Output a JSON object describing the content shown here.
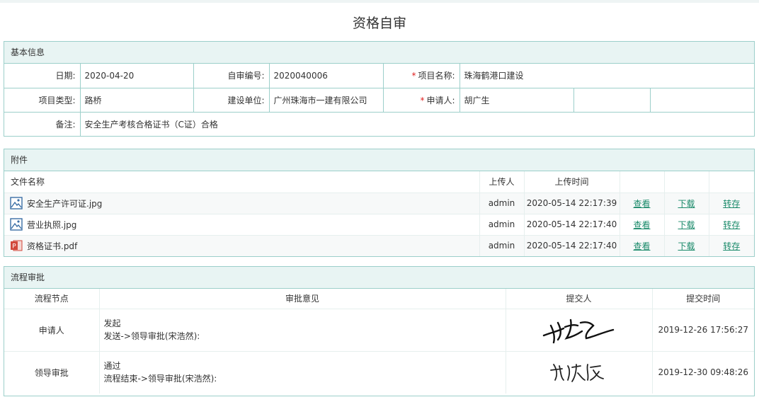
{
  "page": {
    "title": "资格自审"
  },
  "basic": {
    "header": "基本信息",
    "date_label": "日期:",
    "date_value": "2020-04-20",
    "selfno_label": "自审编号:",
    "selfno_value": "2020040006",
    "project_name_label": "项目名称:",
    "project_name_value": "珠海鹤港口建设",
    "project_type_label": "项目类型:",
    "project_type_value": "路桥",
    "build_unit_label": "建设单位:",
    "build_unit_value": "广州珠海市一建有限公司",
    "applicant_label": "申请人:",
    "applicant_value": "胡广生",
    "remark_label": "备注:",
    "remark_value": "安全生产考核合格证书（C证）合格",
    "required_mark": "*"
  },
  "attachments": {
    "header": "附件",
    "columns": {
      "name": "文件名称",
      "uploader": "上传人",
      "time": "上传时间"
    },
    "rows": [
      {
        "name": "安全生产许可证.jpg",
        "uploader": "admin",
        "time": "2020-05-14 22:17:39",
        "icon": "image-file-icon"
      },
      {
        "name": "营业执照.jpg",
        "uploader": "admin",
        "time": "2020-05-14 22:17:40",
        "icon": "image-file-icon"
      },
      {
        "name": "资格证书.pdf",
        "uploader": "admin",
        "time": "2020-05-14 22:17:40",
        "icon": "pdf-file-icon"
      }
    ],
    "actions": {
      "view": "查看",
      "download": "下载",
      "save": "转存"
    }
  },
  "flow": {
    "header": "流程审批",
    "columns": {
      "node": "流程节点",
      "opinion": "审批意见",
      "submitter": "提交人",
      "time": "提交时间"
    },
    "rows": [
      {
        "node": "申请人",
        "opinion": "发起",
        "detail": "发送->领导审批(宋浩然):",
        "time": "2019-12-26 17:56:27"
      },
      {
        "node": "领导审批",
        "opinion": "通过",
        "detail": "流程结束->领导审批(宋浩然):",
        "time": "2019-12-30 09:48:26"
      }
    ]
  },
  "colors": {
    "border": "#9ccfca",
    "header_bg": "#e8f4f3",
    "link": "#1a8a6a",
    "required": "#e02020"
  }
}
